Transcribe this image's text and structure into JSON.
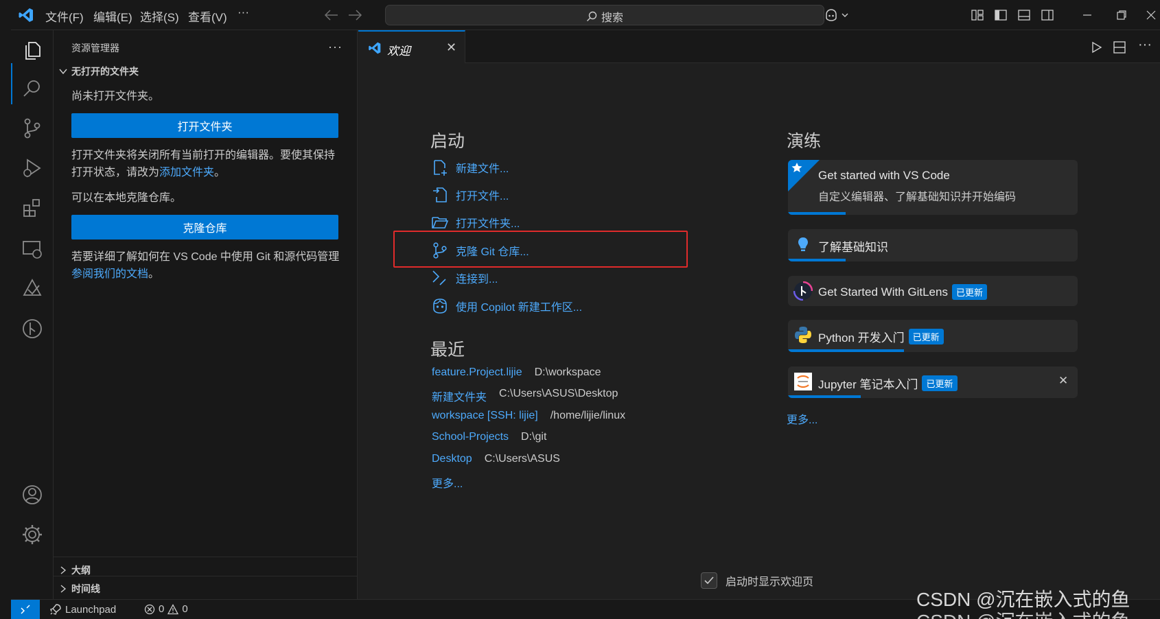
{
  "menu": [
    "文件(F)",
    "编辑(E)",
    "选择(S)",
    "查看(V)",
    "···"
  ],
  "search": {
    "label": "搜索"
  },
  "sidebar": {
    "title": "资源管理器",
    "more": "···",
    "no_folder_section": "无打开的文件夹",
    "no_folder_text": "尚未打开文件夹。",
    "open_folder_button": "打开文件夹",
    "info_text_1": "打开文件夹将关闭所有当前打开的编辑器。要使其保持打开状态，请改为",
    "add_folder_link": "添加文件夹",
    "info_text_1_end": "。",
    "clone_text": "可以在本地克隆仓库。",
    "clone_button": "克隆仓库",
    "git_text": "若要详细了解如何在 VS Code 中使用 Git 和源代码管理",
    "docs_link": "参阅我们的文档",
    "git_text_end": "。",
    "outline_section": "大纲",
    "timeline_section": "时间线"
  },
  "editor": {
    "tab_label": "欢迎",
    "tab_close": "✕",
    "start_heading": "启动",
    "start_items": [
      "新建文件...",
      "打开文件...",
      "打开文件夹...",
      "克隆 Git 仓库...",
      "连接到...",
      "使用 Copilot 新建工作区..."
    ],
    "recent_heading": "最近",
    "recent": [
      {
        "name": "feature.Project.lijie",
        "path": "D:\\workspace"
      },
      {
        "name": "新建文件夹",
        "path": "C:\\Users\\ASUS\\Desktop"
      },
      {
        "name": "workspace [SSH: lijie]",
        "path": "/home/lijie/linux"
      },
      {
        "name": "School-Projects",
        "path": "D:\\git"
      },
      {
        "name": "Desktop",
        "path": "C:\\Users\\ASUS"
      }
    ],
    "recent_more": "更多...",
    "walkthrough_heading": "演练",
    "walkthroughs": [
      {
        "title": "Get started with VS Code",
        "subtitle": "自定义编辑器、了解基础知识并开始编码",
        "badge": "",
        "progress": 0.2
      },
      {
        "title": "了解基础知识",
        "subtitle": "",
        "badge": "",
        "progress": 0.2
      },
      {
        "title": "Get Started With GitLens",
        "subtitle": "",
        "badge": "已更新",
        "progress": 0
      },
      {
        "title": "Python 开发入门",
        "subtitle": "",
        "badge": "已更新",
        "progress": 0.4
      },
      {
        "title": "Jupyter 笔记本入门",
        "subtitle": "",
        "badge": "已更新",
        "progress": 0.25
      }
    ],
    "walkthrough_more": "更多...",
    "close_glyph": "✕",
    "show_on_startup": "启动时显示欢迎页"
  },
  "status": {
    "launchpad": "Launchpad",
    "errors": "0",
    "warnings": "0"
  },
  "watermark": "CSDN @沉在嵌入式的鱼",
  "watermark2": "CSDN @沉在嵌入式的鱼",
  "colors": {
    "accent": "#0078d4",
    "link": "#4daafc",
    "highlight_box": "#e02b2b"
  }
}
